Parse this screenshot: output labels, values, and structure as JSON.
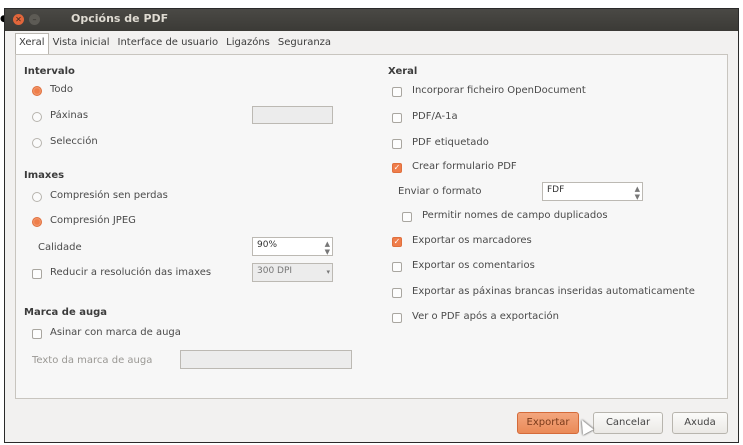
{
  "window": {
    "title": "Opcións de PDF"
  },
  "tabs": [
    {
      "label": "Xeral",
      "active": true
    },
    {
      "label": "Vista inicial"
    },
    {
      "label": "Interface de usuario"
    },
    {
      "label": "Ligazóns"
    },
    {
      "label": "Seguranza"
    }
  ],
  "left": {
    "intervalo": {
      "title": "Intervalo",
      "todo": "Todo",
      "paxinas": "Páxinas",
      "seleccion": "Selección"
    },
    "imaxes": {
      "title": "Imaxes",
      "sen_perdas": "Compresión sen perdas",
      "jpeg": "Compresión JPEG",
      "calidade_label": "Calidade",
      "calidade_value": "90%",
      "reducir": "Reducir a resolución das imaxes",
      "dpi_value": "300 DPI"
    },
    "marca": {
      "title": "Marca de auga",
      "asinar": "Asinar con marca de auga",
      "texto_label": "Texto da marca de auga"
    }
  },
  "right": {
    "title": "Xeral",
    "incorporar": "Incorporar ficheiro OpenDocument",
    "pdfa": "PDF/A-1a",
    "etiquetado": "PDF etiquetado",
    "formulario": "Crear formulario PDF",
    "enviar_label": "Enviar o formato",
    "enviar_value": "FDF",
    "permitir": "Permitir nomes de campo duplicados",
    "marcadores": "Exportar os marcadores",
    "comentarios": "Exportar os comentarios",
    "brancas": "Exportar as páxinas brancas inseridas automaticamente",
    "ver": "Ver o PDF após a exportación"
  },
  "buttons": {
    "exportar": "Exportar",
    "cancelar": "Cancelar",
    "axuda": "Axuda"
  },
  "colors": {
    "accent": "#ef7d4b",
    "titlebar": "#3b3a36"
  }
}
